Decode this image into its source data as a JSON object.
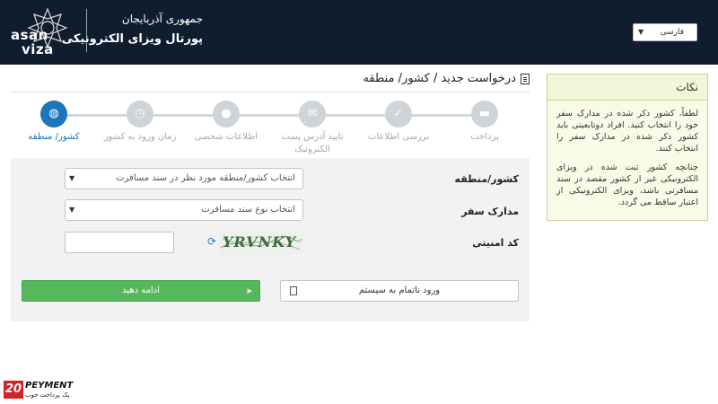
{
  "header": {
    "logo_line1": "asan",
    "logo_line2": "viza",
    "country": "جمهوری آذربایجان",
    "portal": "پورتال ویزای الکترونیکی",
    "language": "فارسی"
  },
  "page_title": "درخواست جدید / کشور/ منطقه",
  "steps": [
    {
      "label": "کشور/ منطقه",
      "icon": "globe-icon",
      "active": true
    },
    {
      "label": "زمان ورود به کشور",
      "icon": "clock-icon",
      "active": false
    },
    {
      "label": "اطلاعات شخصی",
      "icon": "user-icon",
      "active": false
    },
    {
      "label": "تایید آدرس پست الکترونیک",
      "icon": "envelope-icon",
      "active": false
    },
    {
      "label": "بررسی اطلاعات",
      "icon": "check-icon",
      "active": false
    },
    {
      "label": "پرداخت",
      "icon": "card-icon",
      "active": false
    }
  ],
  "form": {
    "country_label": "کشور/منطقه",
    "country_select": "انتخاب کشور/منطقه مورد نظر در سند مسافرت",
    "doc_label": "مدارک سفر",
    "doc_select": "انتخاب نوع سند مسافرت",
    "captcha_label": "کد امنیتی",
    "captcha_text": "YRVNKY",
    "continue_button": "ادامه دهید",
    "incomplete_button": "ورود ناتمام به سیستم"
  },
  "notes": {
    "title": "نکات",
    "p1": "لطفاً، کشور ذکر شده در مدارک سفر خود را انتخاب کنید. افراد دوتابعیتی باید کشور ذکر شده در مدارک سفر را انتخاب کنند.",
    "p2": "چنانچه کشور ثبت شده در ویزای الکترونیکی غیر از کشور مقصد در سند مسافرتی باشد، ویزای الکترونیکی از اعتبار ساقط می گردد."
  },
  "watermark": {
    "number": "20",
    "brand": "PEYMENT",
    "tagline": "یک پرداخت خوب"
  },
  "colors": {
    "header_bg": "#0f1d2e",
    "accent": "#1c77ba",
    "green_button": "#57b75c",
    "notes_bg": "#fafbe7"
  }
}
